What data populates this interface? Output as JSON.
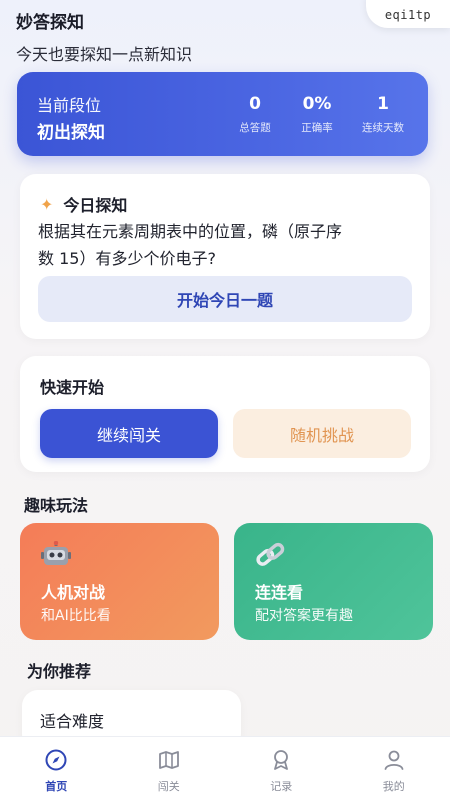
{
  "badge": "eqi1tp",
  "header": {
    "title": "妙答探知",
    "subtitle": "今天也要探知一点新知识"
  },
  "rank": {
    "label": "当前段位",
    "value": "初出探知",
    "stats": [
      {
        "value": "0",
        "label": "总答题"
      },
      {
        "value": "0%",
        "label": "正确率"
      },
      {
        "value": "1",
        "label": "连续天数"
      }
    ]
  },
  "daily": {
    "icon": "sparkle-icon",
    "title": "今日探知",
    "question_line1": "根据其在元素周期表中的位置，磷（原子序",
    "question_line2": "数 15）有多少个价电子?",
    "button": "开始今日一题"
  },
  "quick": {
    "title": "快速开始",
    "continue": "继续闯关",
    "random": "随机挑战"
  },
  "fun": {
    "title": "趣味玩法",
    "cards": [
      {
        "icon": "robot-icon",
        "name": "人机对战",
        "desc": "和AI比比看"
      },
      {
        "icon": "chain-link-icon",
        "name": "连连看",
        "desc": "配对答案更有趣"
      }
    ]
  },
  "recommend": {
    "title": "为你推荐",
    "items": [
      {
        "label": "适合难度"
      }
    ]
  },
  "tabs": [
    {
      "label": "首页",
      "icon": "compass-icon",
      "active": true
    },
    {
      "label": "闯关",
      "icon": "map-icon",
      "active": false
    },
    {
      "label": "记录",
      "icon": "medal-icon",
      "active": false
    },
    {
      "label": "我的",
      "icon": "user-icon",
      "active": false
    }
  ],
  "colors": {
    "primary": "#3b53d4",
    "accent_orange": "#f47c58",
    "accent_green": "#39b48a",
    "random_text": "#e19552"
  }
}
